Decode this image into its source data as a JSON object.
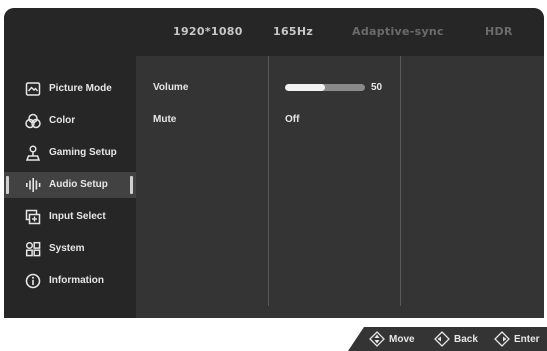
{
  "header": {
    "resolution": "1920*1080",
    "refresh_rate": "165Hz",
    "adaptive_sync": "Adaptive-sync",
    "hdr": "HDR"
  },
  "sidebar": {
    "items": [
      {
        "label": "Picture Mode",
        "icon": "picture-mode-icon"
      },
      {
        "label": "Color",
        "icon": "color-icon"
      },
      {
        "label": "Gaming Setup",
        "icon": "gaming-setup-icon"
      },
      {
        "label": "Audio Setup",
        "icon": "audio-setup-icon",
        "selected": true
      },
      {
        "label": "Input Select",
        "icon": "input-select-icon"
      },
      {
        "label": "System",
        "icon": "system-icon"
      },
      {
        "label": "Information",
        "icon": "information-icon"
      }
    ]
  },
  "options": {
    "volume": {
      "label": "Volume",
      "value": "50",
      "level": 0.5
    },
    "mute": {
      "label": "Mute",
      "value": "Off"
    }
  },
  "footer": {
    "move": "Move",
    "back": "Back",
    "enter": "Enter"
  },
  "colors": {
    "panel": "#343434",
    "sidebar": "#262626",
    "selected": "#424242",
    "text": "#e6e6e6",
    "dimmed": "#6b6b6b"
  }
}
